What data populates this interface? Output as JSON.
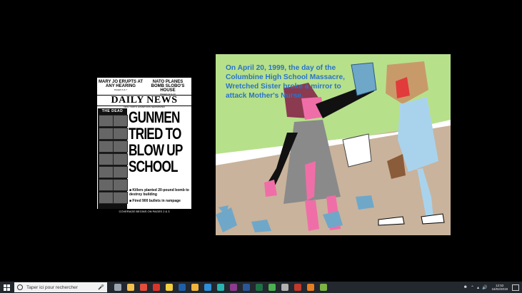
{
  "newspaper": {
    "teaser_left": "MARY JO ERUPTS AT ANY HEARING",
    "teaser_left_sub": "PAGES 6 & 7",
    "teaser_right": "NATO PLANES BOMB SLOBO'S HOUSE",
    "teaser_right_sub": "PAGES 22 & 23",
    "masthead": "DAILY NEWS",
    "tagline": "NEW YORK'S HOMETOWN NEWSPAPER",
    "dead_label": "THE DEAD",
    "headline_lines": [
      "GUNMEN",
      "TRIED TO",
      "BLOW UP",
      "SCHOOL"
    ],
    "bullet_1": "■ Killers planted 20-pound bomb to destroy building",
    "bullet_2": "■ Fired 900 bullets in rampage",
    "footer": "COVERAGE BEGINS ON PAGES 2 & 3"
  },
  "artwork": {
    "caption": "On April 20, 1999, the day of the Columbine High School Massacre, Wretched Sister broke a mirror to attack Mother's Nurse.",
    "colors": {
      "sky": "#b7e08a",
      "ground": "#c9b39c",
      "caption": "#2a73c9",
      "dress": "#8a8a8a",
      "skin": "#f06ea8",
      "hair": "#8b3a4f",
      "nurse_coat": "#a9d3ec",
      "nurse_head": "#c89a6a"
    }
  },
  "taskbar": {
    "search_placeholder": "Taper ici pour rechercher",
    "time": "12:52",
    "date": "16/02/2019",
    "start_icon": "windows-logo-icon",
    "search_icon": "cortana-circle-icon",
    "mic_icon": "microphone-icon",
    "app_icons": [
      {
        "name": "task-view-icon",
        "color": "#9aa4b1"
      },
      {
        "name": "file-explorer-icon",
        "color": "#f2c14e"
      },
      {
        "name": "chrome-icon",
        "color": "#e44d3a"
      },
      {
        "name": "acrobat-icon",
        "color": "#d9342b"
      },
      {
        "name": "sticky-notes-icon",
        "color": "#f4d03f"
      },
      {
        "name": "photoshop-icon",
        "color": "#1f5fa8"
      },
      {
        "name": "folder-icon",
        "color": "#f0b43c"
      },
      {
        "name": "app-blue-icon",
        "color": "#2f8fd8"
      },
      {
        "name": "app-teal-icon",
        "color": "#2ab4b0"
      },
      {
        "name": "app-purple-icon",
        "color": "#8e3b8f"
      },
      {
        "name": "word-icon",
        "color": "#2b5797"
      },
      {
        "name": "excel-icon",
        "color": "#1e7145"
      },
      {
        "name": "app-green-icon",
        "color": "#4caf50"
      },
      {
        "name": "app-gray-icon",
        "color": "#b0b0b0"
      },
      {
        "name": "app-red-icon",
        "color": "#c0392b"
      },
      {
        "name": "app-orange-icon",
        "color": "#e67e22"
      },
      {
        "name": "app-lime-icon",
        "color": "#7cb342"
      }
    ]
  }
}
